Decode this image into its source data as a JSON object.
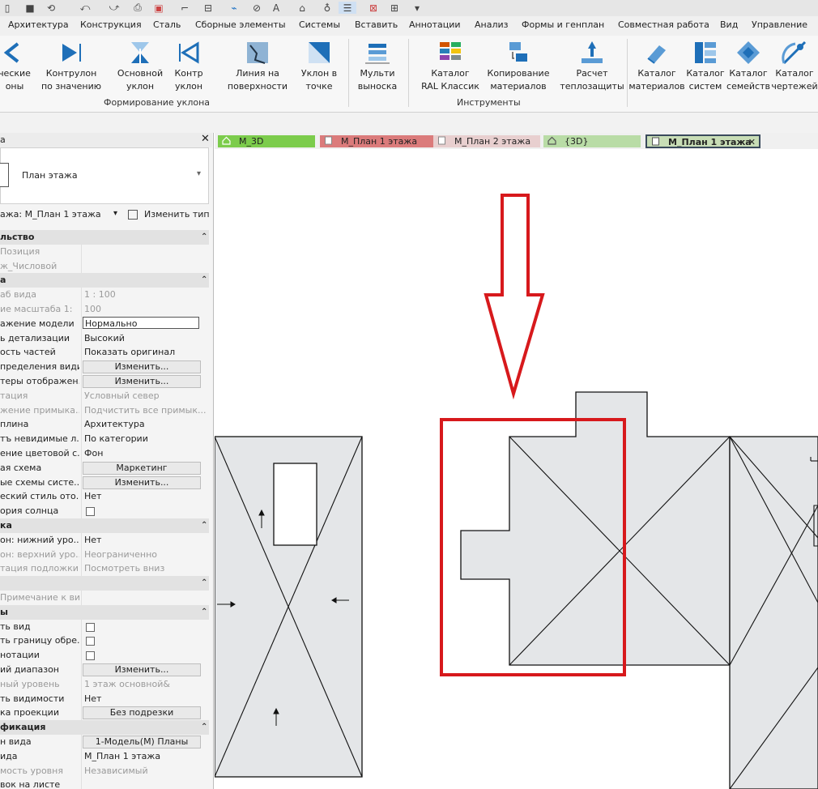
{
  "app": {
    "accent": "#d7191c",
    "roof_fill": "#e4e6e8"
  },
  "ribbon_tabs": [
    "Архитектура",
    "Конструкция",
    "Сталь",
    "Сборные элементы",
    "Системы",
    "Вставить",
    "Аннотации",
    "Анализ",
    "Формы и генплан",
    "Совместная работа",
    "Вид",
    "Управление"
  ],
  "ribbon": {
    "buttons": [
      {
        "label1": "ческие",
        "label2": "оны"
      },
      {
        "label1": "Контрулон",
        "label2": "по значению"
      },
      {
        "label1": "Основной",
        "label2": "уклон"
      },
      {
        "label1": "Контр",
        "label2": "уклон"
      },
      {
        "label1": "Линия на",
        "label2": "поверхности"
      },
      {
        "label1": "Уклон в",
        "label2": "точке"
      },
      {
        "label1": "Мульти",
        "label2": "выноска"
      },
      {
        "label1": "Каталог",
        "label2": "RAL Классик"
      },
      {
        "label1": "Копирование",
        "label2": "материалов"
      },
      {
        "label1": "Расчет",
        "label2": "теплозащиты"
      },
      {
        "label1": "Каталог",
        "label2": "материалов"
      },
      {
        "label1": "Каталог",
        "label2": "систем"
      },
      {
        "label1": "Каталог",
        "label2": "семейств"
      },
      {
        "label1": "Каталог",
        "label2": "чертежей"
      }
    ],
    "panels": {
      "slope": "Формирование уклона",
      "tools": "Инструменты"
    }
  },
  "props": {
    "title_fragment": "а",
    "type_name": "План этажа",
    "selector": "ажа: М_План 1 этажа",
    "edit_type": "Изменить тип",
    "rows": [
      {
        "k": "льство",
        "h": true
      },
      {
        "k": "Позиция",
        "v": "",
        "d": true
      },
      {
        "k": "ж_Числовой",
        "v": "",
        "d": true
      },
      {
        "k": "а",
        "h": true
      },
      {
        "k": "аб вида",
        "v": "1 : 100",
        "d": true
      },
      {
        "k": "ие масштаба   1:",
        "v": "100",
        "d": true
      },
      {
        "k": "ажение модели",
        "v": "Нормально",
        "i": true
      },
      {
        "k": "ь детализации",
        "v": "Высокий"
      },
      {
        "k": "ость частей",
        "v": "Показать оригинал"
      },
      {
        "k": "пределения види...",
        "v": "Изменить...",
        "b": true
      },
      {
        "k": "теры отображен...",
        "v": "Изменить...",
        "b": true
      },
      {
        "k": "тация",
        "v": "Условный север",
        "d": true
      },
      {
        "k": "жение примыка...",
        "v": "Подчистить все примык...",
        "d": true
      },
      {
        "k": "плина",
        "v": "Архитектура"
      },
      {
        "k": "тъ невидимые л...",
        "v": "По категории"
      },
      {
        "k": "ение цветовой с...",
        "v": "Фон"
      },
      {
        "k": "ая схема",
        "v": "Маркетинг",
        "b": true
      },
      {
        "k": "ые схемы систе...",
        "v": "Изменить...",
        "b": true
      },
      {
        "k": "еский стиль ото...",
        "v": "Нет"
      },
      {
        "k": "ория солнца",
        "c": true
      },
      {
        "k": "ка",
        "h": true
      },
      {
        "k": "он: нижний уро...",
        "v": "Нет"
      },
      {
        "k": "он: верхний уро...",
        "v": "Неограниченно",
        "d": true
      },
      {
        "k": "тация подложки",
        "v": "Посмотреть вниз",
        "d": true
      },
      {
        "k": "",
        "h": true
      },
      {
        "k": "Примечание к ви...",
        "v": "",
        "d": true
      },
      {
        "k": "ы",
        "h": true
      },
      {
        "k": "ть вид",
        "c": true
      },
      {
        "k": "ть границу обре...",
        "c": true
      },
      {
        "k": "нотации",
        "c": true
      },
      {
        "k": "ий диапазон",
        "v": "Изменить...",
        "b": true
      },
      {
        "k": "ный уровень",
        "v": "1 этаж основной&",
        "d": true
      },
      {
        "k": "ть видимости",
        "v": "Нет"
      },
      {
        "k": "ка проекции",
        "v": "Без подрезки",
        "b": true
      },
      {
        "k": "фикация",
        "h": true
      },
      {
        "k": "н вида",
        "v": "1-Модель(М) Планы",
        "b": true
      },
      {
        "k": "ида",
        "v": "М_План 1 этажа"
      },
      {
        "k": "мость уровня",
        "v": "Независимый",
        "d": true
      },
      {
        "k": "вок на листе",
        "v": ""
      }
    ]
  },
  "view_tabs": [
    {
      "label": "М_3D",
      "bg": "#7ccc4c"
    },
    {
      "label": "М_План 1 этажа",
      "bg": "#db7b7b"
    },
    {
      "label": "М_План 2 этажа",
      "bg": "#e8cfcf"
    },
    {
      "label": "{3D}",
      "bg": "#b9dca6"
    },
    {
      "label": "М_План 1 этажа",
      "bg": "#c8ddb6",
      "active": true,
      "close": "✕"
    }
  ]
}
